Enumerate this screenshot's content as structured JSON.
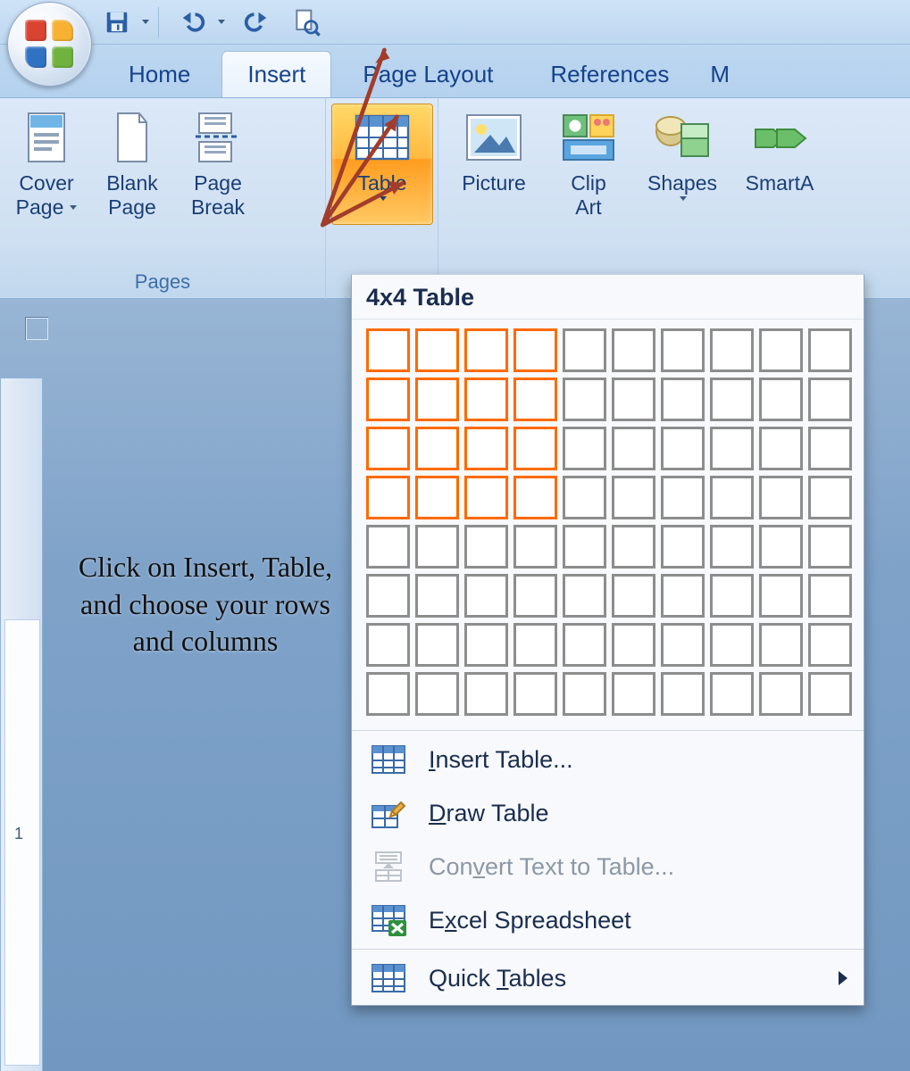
{
  "qat": {
    "buttons": [
      "save-icon",
      "undo-icon",
      "redo-icon",
      "print-preview-icon"
    ]
  },
  "tabs": {
    "home": "Home",
    "insert": "Insert",
    "page_layout": "Page Layout",
    "references": "References",
    "more": "M"
  },
  "ribbon": {
    "pages_group_label": "Pages",
    "cover_page": "Cover",
    "cover_page2": "Page",
    "blank_page": "Blank",
    "blank_page2": "Page",
    "page_break": "Page",
    "page_break2": "Break",
    "table": "Table",
    "picture": "Picture",
    "clip": "Clip",
    "clip2": "Art",
    "shapes": "Shapes",
    "smartart": "SmartA"
  },
  "dropdown": {
    "title": "4x4 Table",
    "sel_cols": 4,
    "sel_rows": 4,
    "total_cols": 10,
    "total_rows": 8,
    "insert": "Insert Table...",
    "draw": "Draw Table",
    "convert": "Convert Text to Table...",
    "excel": "Excel Spreadsheet",
    "quick": "Quick Tables"
  },
  "annotation": "Click on Insert, Table, and choose your rows and columns"
}
